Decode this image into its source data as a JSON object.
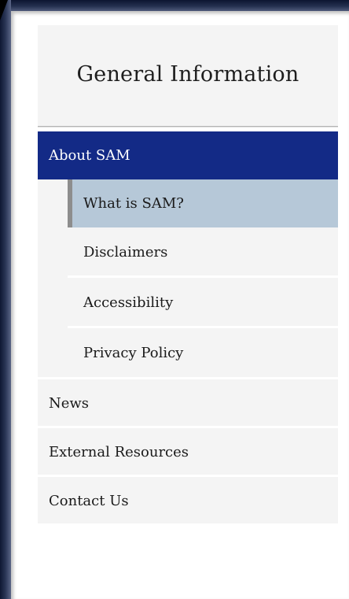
{
  "sidebar": {
    "title": "General Information",
    "items": [
      {
        "label": "About SAM",
        "active": true,
        "children": [
          {
            "label": "What is SAM?",
            "selected": true
          },
          {
            "label": "Disclaimers"
          },
          {
            "label": "Accessibility"
          },
          {
            "label": "Privacy Policy"
          }
        ]
      },
      {
        "label": "News"
      },
      {
        "label": "External Resources"
      },
      {
        "label": "Contact Us"
      }
    ]
  },
  "colors": {
    "active_bg": "#132a86",
    "selected_bg": "#b6c8d8",
    "panel_bg": "#f4f4f4",
    "frame_dark": "#1a2442"
  }
}
